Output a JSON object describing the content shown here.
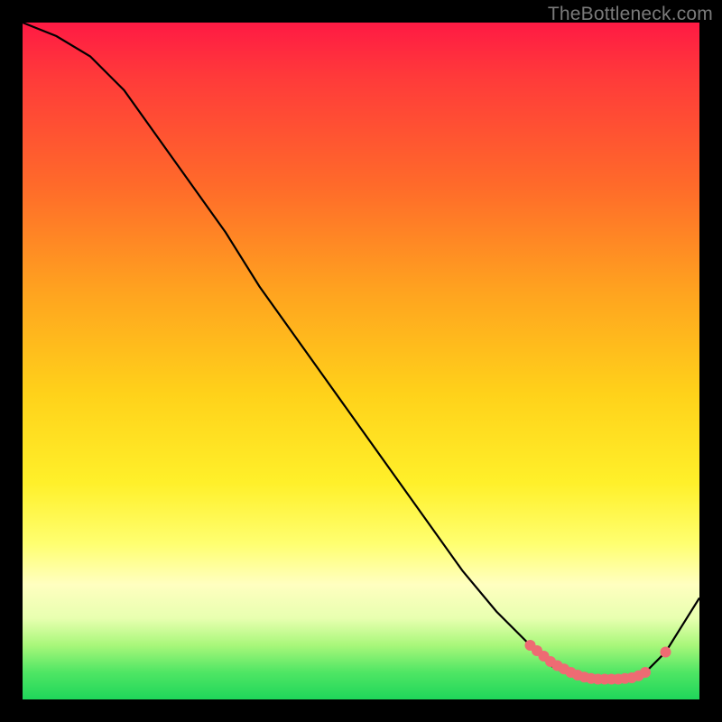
{
  "attribution": "TheBottleneck.com",
  "chart_data": {
    "type": "line",
    "x": [
      0,
      5,
      10,
      15,
      20,
      25,
      30,
      35,
      40,
      45,
      50,
      55,
      60,
      65,
      70,
      75,
      78,
      80,
      82,
      85,
      88,
      90,
      92,
      95,
      100
    ],
    "y": [
      100,
      98,
      95,
      90,
      83,
      76,
      69,
      61,
      54,
      47,
      40,
      33,
      26,
      19,
      13,
      8,
      5,
      4,
      3.2,
      3,
      3,
      3.2,
      4,
      7,
      15
    ],
    "title": "",
    "xlabel": "",
    "ylabel": "",
    "xlim": [
      0,
      100
    ],
    "ylim": [
      0,
      100
    ],
    "markers": {
      "x": [
        75,
        76,
        77,
        78,
        79,
        80,
        81,
        82,
        83,
        84,
        85,
        86,
        87,
        88,
        89,
        90,
        91,
        92,
        95
      ],
      "y": [
        8,
        7.2,
        6.4,
        5.6,
        5,
        4.5,
        4,
        3.6,
        3.3,
        3.1,
        3,
        3,
        3,
        3,
        3.1,
        3.2,
        3.5,
        4,
        7
      ]
    }
  }
}
